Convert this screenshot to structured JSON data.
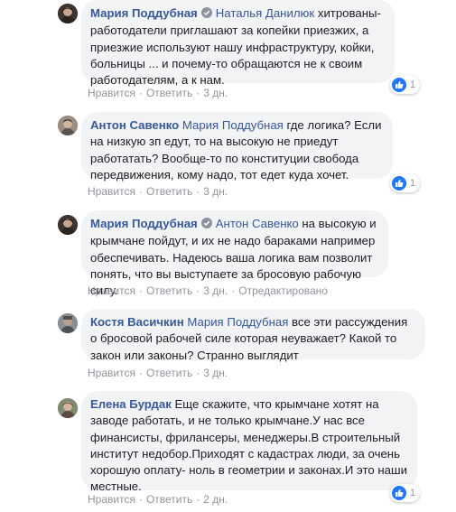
{
  "comments": [
    {
      "author": "Мария Поддубная",
      "verified": true,
      "tag": "Наталья Данилюк",
      "text": " хитрованы-работодатели приглашают за копейки приезжих, а приезжие используют нашу инфраструктуру, койки, больницы ... и почему-то обращаются не к своим работодателям, а к нам.",
      "actions": {
        "like": "Нравится",
        "reply": "Ответить",
        "time": "3 дн.",
        "edited": ""
      },
      "reactions": "1"
    },
    {
      "author": "Антон Савенко",
      "verified": false,
      "tag": "Мария Поддубная",
      "text": " где логика? Если на низкую зп едут, то на высокую не приедут работатать? Вообще-то по конституции свобода передвижения, кому надо, тот едет куда хочет.",
      "actions": {
        "like": "Нравится",
        "reply": "Ответить",
        "time": "3 дн.",
        "edited": ""
      },
      "reactions": "1"
    },
    {
      "author": "Мария Поддубная",
      "verified": true,
      "tag": "Антон Савенко",
      "text": " на высокую и крымчане пойдут, и их не надо бараками например обеспечивать. Надеюсь ваша логика вам позволит понять, что вы выступаете за бросовую рабочую силу.",
      "actions": {
        "like": "Нравится",
        "reply": "Ответить",
        "time": "3 дн.",
        "edited": "Отредактировано"
      },
      "reactions": ""
    },
    {
      "author": "Костя Васичкин",
      "verified": false,
      "tag": "Мария Поддубная",
      "text": " все эти рассуждения о бросовой рабочей силе которая неуважает? Какой то закон или законы? Странно выглядит",
      "actions": {
        "like": "Нравится",
        "reply": "Ответить",
        "time": "3 дн.",
        "edited": ""
      },
      "reactions": ""
    },
    {
      "author": "Елена Бурдак",
      "verified": false,
      "tag": "",
      "text": " Еще скажите, что крымчане хотят на заводе работать, и не только крымчане.У нас все финансисты, фрилансеры, менеджеры.В строительный институт недобор.Приходят с кадастрах люди, за очень хорошую оплату- ноль в геометрии и законах.И это наши местные.",
      "actions": {
        "like": "Нравится",
        "reply": "Ответить",
        "time": "2 дн.",
        "edited": ""
      },
      "reactions": "1"
    }
  ],
  "colors": {
    "link": "#385898",
    "bubble": "#f2f3f5",
    "meta": "#90949c",
    "like": "#2078f4"
  }
}
